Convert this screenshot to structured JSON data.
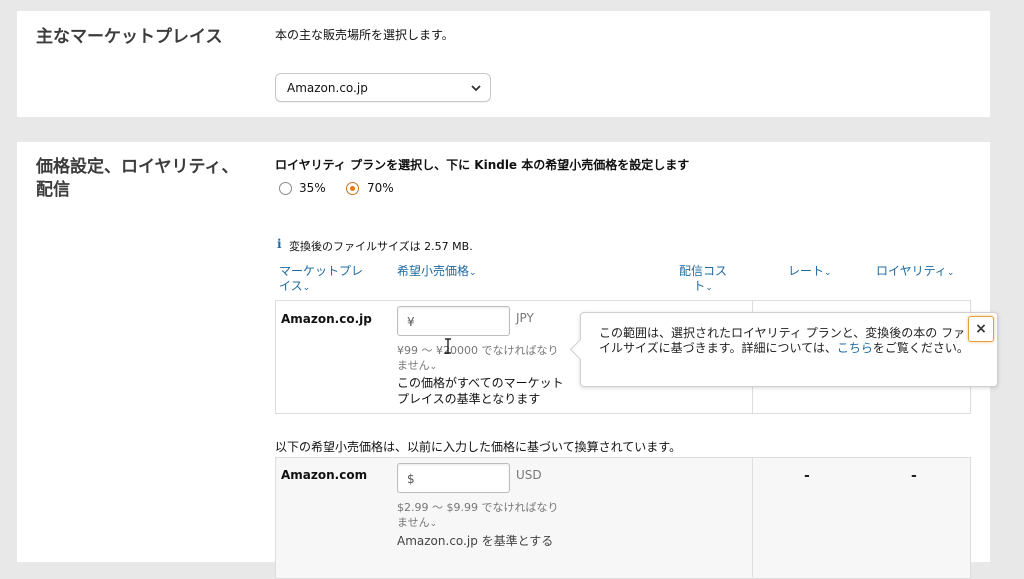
{
  "marketplace_section": {
    "title": "主なマーケットプレイス",
    "description": "本の主な販売場所を選択します。",
    "select_value": "Amazon.co.jp"
  },
  "pricing_section": {
    "title_line1": "価格設定、ロイヤリティ、",
    "title_line2": "配信",
    "instruction": "ロイヤリティ プランを選択し、下に Kindle 本の希望小売価格を設定します",
    "royalty_options": [
      {
        "label": "35%",
        "selected": false
      },
      {
        "label": "70%",
        "selected": true
      }
    ],
    "info_icon": "i",
    "file_size_note": "変換後のファイルサイズは 2.57 MB.",
    "columns": {
      "marketplace_line1": "マーケットプレ",
      "marketplace_line2": "イス",
      "list_price": "希望小売価格",
      "delivery_cost_line1": "配信コス",
      "delivery_cost_line2": "ト",
      "rate": "レート",
      "royalty": "ロイヤリティ",
      "caret": "⌄"
    },
    "jp_row": {
      "marketplace": "Amazon.co.jp",
      "placeholder": "¥",
      "currency": "JPY",
      "range_line1": "¥99 ～ ¥20000 でなければなり",
      "range_line2": "ません",
      "base_line1": "この価格がすべてのマーケット",
      "base_line2": "プレイスの基準となります"
    },
    "converted_note": "以下の希望小売価格は、以前に入力した価格に基づいて換算されています。",
    "com_row": {
      "marketplace": "Amazon.com",
      "placeholder": "$",
      "currency": "USD",
      "range_line1": "$2.99 ～ $9.99 でなければなり",
      "range_line2": "ません",
      "base_line1": "Amazon.co.jp を基準とする",
      "rate": "-",
      "royalty": "-"
    },
    "tooltip": {
      "text_before": "この範囲は、選択されたロイヤリティ プランと、変換後の本の ファイルサイズに基づきます。詳細については、",
      "link": "こちら",
      "text_after": "をご覧ください。",
      "close": "×"
    }
  }
}
